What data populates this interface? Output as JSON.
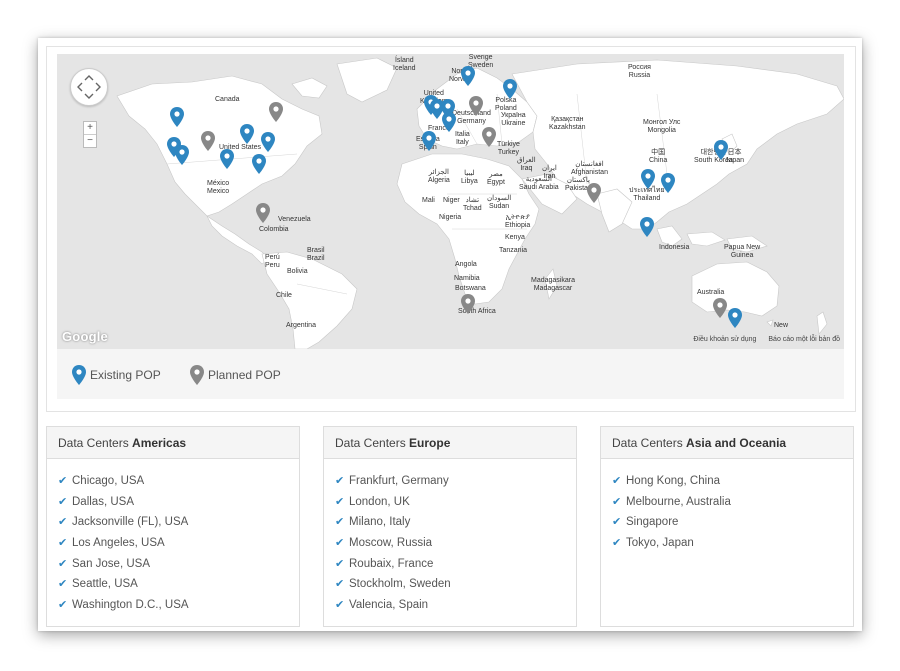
{
  "map": {
    "attribution": "Google",
    "footer_terms": "Điều khoản sử dụng",
    "footer_report": "Báo cáo một lỗi bản đồ",
    "zoom_in": "+",
    "zoom_out": "−",
    "colors": {
      "existing": "#2e86c1",
      "planned": "#888888",
      "land": "#ffffff",
      "water": "#e5e5e5"
    },
    "labels": [
      {
        "text": "Ísland",
        "sub": "Iceland"
      },
      {
        "text": "Sverige",
        "sub": "Sweden"
      },
      {
        "text": "Norge",
        "sub": "Norway"
      },
      {
        "text": "Россия",
        "sub": "Russia"
      },
      {
        "text": "Canada",
        "sub": ""
      },
      {
        "text": "United",
        "sub": "Kingdom"
      },
      {
        "text": "Polska",
        "sub": "Poland"
      },
      {
        "text": "Deutschland",
        "sub": "Germany"
      },
      {
        "text": "Україна",
        "sub": "Ukraine"
      },
      {
        "text": "France",
        "sub": ""
      },
      {
        "text": "Italia",
        "sub": "Italy"
      },
      {
        "text": "España",
        "sub": "Spain"
      },
      {
        "text": "Қазақстан",
        "sub": "Kazakhstan"
      },
      {
        "text": "Монгол Улс",
        "sub": "Mongolia"
      },
      {
        "text": "United States",
        "sub": ""
      },
      {
        "text": "Türkiye",
        "sub": "Turkey"
      },
      {
        "text": "中国",
        "sub": "China"
      },
      {
        "text": "대한민국",
        "sub": "South Korea"
      },
      {
        "text": "日本",
        "sub": "Japan"
      },
      {
        "text": "الجزائر",
        "sub": "Algeria"
      },
      {
        "text": "ليبيا",
        "sub": "Libya"
      },
      {
        "text": "مصر",
        "sub": "Egypt"
      },
      {
        "text": "العراق",
        "sub": "Iraq"
      },
      {
        "text": "ایران",
        "sub": "Iran"
      },
      {
        "text": "افغانستان",
        "sub": "Afghanistan"
      },
      {
        "text": "پاکستان",
        "sub": "Pakistan"
      },
      {
        "text": "México",
        "sub": "Mexico"
      },
      {
        "text": "السعودية",
        "sub": "Saudi Arabia"
      },
      {
        "text": "ประเทศไทย",
        "sub": "Thailand"
      },
      {
        "text": "Mali",
        "sub": ""
      },
      {
        "text": "Niger",
        "sub": ""
      },
      {
        "text": "تشاد",
        "sub": "Tchad"
      },
      {
        "text": "السودان",
        "sub": "Sudan"
      },
      {
        "text": "ኢትዮጵያ",
        "sub": "Ethiopia"
      },
      {
        "text": "Nigeria",
        "sub": ""
      },
      {
        "text": "Venezuela",
        "sub": ""
      },
      {
        "text": "Colombia",
        "sub": ""
      },
      {
        "text": "Kenya",
        "sub": ""
      },
      {
        "text": "Indonesia",
        "sub": ""
      },
      {
        "text": "Papua New",
        "sub": "Guinea"
      },
      {
        "text": "Brasil",
        "sub": "Brazil"
      },
      {
        "text": "Perú",
        "sub": "Peru"
      },
      {
        "text": "Tanzania",
        "sub": ""
      },
      {
        "text": "Bolivia",
        "sub": ""
      },
      {
        "text": "Angola",
        "sub": ""
      },
      {
        "text": "Madagasikara",
        "sub": "Madagascar"
      },
      {
        "text": "Namibia",
        "sub": ""
      },
      {
        "text": "Botswana",
        "sub": ""
      },
      {
        "text": "Australia",
        "sub": ""
      },
      {
        "text": "Chile",
        "sub": ""
      },
      {
        "text": "South Africa",
        "sub": ""
      },
      {
        "text": "Argentina",
        "sub": ""
      },
      {
        "text": "New",
        "sub": ""
      }
    ]
  },
  "legend": {
    "existing_label": "Existing POP",
    "planned_label": "Planned POP"
  },
  "datacenters": [
    {
      "prefix": "Data Centers ",
      "region": "Americas",
      "items": [
        "Chicago, USA",
        "Dallas, USA",
        "Jacksonville (FL), USA",
        "Los Angeles, USA",
        "San Jose, USA",
        "Seattle, USA",
        "Washington D.C., USA"
      ]
    },
    {
      "prefix": "Data Centers ",
      "region": "Europe",
      "items": [
        "Frankfurt, Germany",
        "London, UK",
        "Milano, Italy",
        "Moscow, Russia",
        "Roubaix, France",
        "Stockholm, Sweden",
        "Valencia, Spain"
      ]
    },
    {
      "prefix": "Data Centers ",
      "region": "Asia and Oceania",
      "items": [
        "Hong Kong, China",
        "Melbourne, Australia",
        "Singapore",
        "Tokyo, Japan"
      ]
    }
  ]
}
